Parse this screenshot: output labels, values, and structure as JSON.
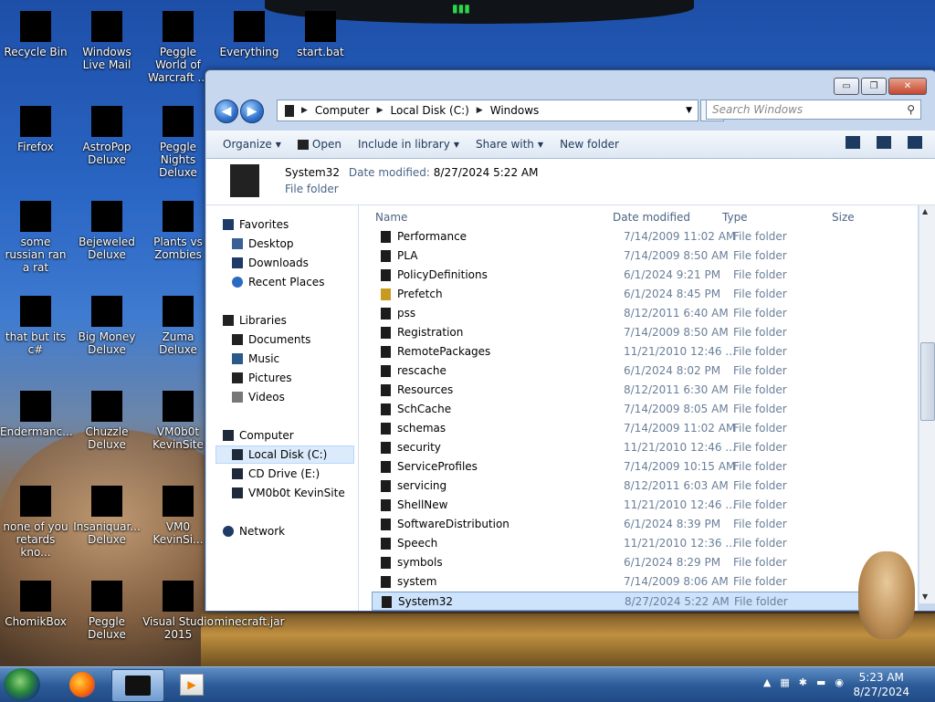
{
  "desktop": {
    "icons": [
      {
        "label": "Recycle Bin",
        "icon": "recycle-bin-icon"
      },
      {
        "label": "Windows Live Mail",
        "icon": "mail-icon"
      },
      {
        "label": "Peggle World of Warcraft ...",
        "icon": "peggle-icon"
      },
      {
        "label": "Everything",
        "icon": "search-app-icon"
      },
      {
        "label": "start.bat",
        "icon": "batch-file-icon"
      },
      {
        "label": "Firefox",
        "icon": "firefox-icon"
      },
      {
        "label": "AstroPop Deluxe",
        "icon": "game-icon"
      },
      {
        "label": "Peggle Nights Deluxe",
        "icon": "peggle-icon"
      },
      {
        "label": "some russian ran a rat",
        "icon": "file-icon"
      },
      {
        "label": "Bejeweled Deluxe",
        "icon": "game-icon"
      },
      {
        "label": "Plants vs Zombies",
        "icon": "game-icon"
      },
      {
        "label": "that but its c#",
        "icon": "file-icon"
      },
      {
        "label": "Big Money Deluxe",
        "icon": "game-icon"
      },
      {
        "label": "Zuma Deluxe",
        "icon": "game-icon"
      },
      {
        "label": "Endermanc...",
        "icon": "app-icon"
      },
      {
        "label": "Chuzzle Deluxe",
        "icon": "game-icon"
      },
      {
        "label": "VM0b0t KevinSite",
        "icon": "app-icon"
      },
      {
        "label": "none of you retards kno...",
        "icon": "file-icon"
      },
      {
        "label": "Insaniquar... Deluxe",
        "icon": "game-icon"
      },
      {
        "label": "VM0 KevinSi...",
        "icon": "app-icon"
      },
      {
        "label": "ChomikBox",
        "icon": "app-icon"
      },
      {
        "label": "Peggle Deluxe",
        "icon": "peggle-icon"
      },
      {
        "label": "Visual Studio 2015",
        "icon": "visual-studio-icon"
      },
      {
        "label": "minecraft.jar",
        "icon": "jar-file-icon"
      }
    ]
  },
  "window": {
    "controls": {
      "minimize": "▭",
      "maximize": "❐",
      "close": "✕"
    },
    "address": {
      "crumbs": [
        "Computer",
        "Local Disk (C:)",
        "Windows"
      ]
    },
    "search": {
      "placeholder": "Search Windows"
    },
    "toolbar": {
      "organize": "Organize",
      "open": "Open",
      "include": "Include in library",
      "share": "Share with",
      "new_folder": "New folder"
    },
    "details": {
      "name": "System32",
      "modified_label": "Date modified:",
      "modified_value": "8/27/2024 5:22 AM",
      "type": "File folder"
    },
    "nav": {
      "favorites": "Favorites",
      "desktop": "Desktop",
      "downloads": "Downloads",
      "recent": "Recent Places",
      "libraries": "Libraries",
      "documents": "Documents",
      "music": "Music",
      "pictures": "Pictures",
      "videos": "Videos",
      "computer": "Computer",
      "local_disk": "Local Disk (C:)",
      "cd_drive": "CD Drive (E:)",
      "vm_site": "VM0b0t KevinSite",
      "network": "Network"
    },
    "columns": {
      "name": "Name",
      "date": "Date modified",
      "type": "Type",
      "size": "Size"
    },
    "rows": [
      {
        "name": "Performance",
        "date": "7/14/2009 11:02 AM",
        "type": "File folder"
      },
      {
        "name": "PLA",
        "date": "7/14/2009 8:50 AM",
        "type": "File folder"
      },
      {
        "name": "PolicyDefinitions",
        "date": "6/1/2024 9:21 PM",
        "type": "File folder"
      },
      {
        "name": "Prefetch",
        "date": "6/1/2024 8:45 PM",
        "type": "File folder"
      },
      {
        "name": "pss",
        "date": "8/12/2011 6:40 AM",
        "type": "File folder"
      },
      {
        "name": "Registration",
        "date": "7/14/2009 8:50 AM",
        "type": "File folder"
      },
      {
        "name": "RemotePackages",
        "date": "11/21/2010 12:46 ...",
        "type": "File folder"
      },
      {
        "name": "rescache",
        "date": "6/1/2024 8:02 PM",
        "type": "File folder"
      },
      {
        "name": "Resources",
        "date": "8/12/2011 6:30 AM",
        "type": "File folder"
      },
      {
        "name": "SchCache",
        "date": "7/14/2009 8:05 AM",
        "type": "File folder"
      },
      {
        "name": "schemas",
        "date": "7/14/2009 11:02 AM",
        "type": "File folder"
      },
      {
        "name": "security",
        "date": "11/21/2010 12:46 ...",
        "type": "File folder"
      },
      {
        "name": "ServiceProfiles",
        "date": "7/14/2009 10:15 AM",
        "type": "File folder"
      },
      {
        "name": "servicing",
        "date": "8/12/2011 6:03 AM",
        "type": "File folder"
      },
      {
        "name": "ShellNew",
        "date": "11/21/2010 12:46 ...",
        "type": "File folder"
      },
      {
        "name": "SoftwareDistribution",
        "date": "6/1/2024 8:39 PM",
        "type": "File folder"
      },
      {
        "name": "Speech",
        "date": "11/21/2010 12:36 ...",
        "type": "File folder"
      },
      {
        "name": "symbols",
        "date": "6/1/2024 8:29 PM",
        "type": "File folder"
      },
      {
        "name": "system",
        "date": "7/14/2009 8:06 AM",
        "type": "File folder"
      },
      {
        "name": "System32",
        "date": "8/27/2024 5:22 AM",
        "type": "File folder",
        "selected": true
      }
    ]
  },
  "taskbar": {
    "time": "5:23 AM",
    "date": "8/27/2024",
    "apps": [
      "firefox-icon",
      "explorer-icon",
      "media-player-icon"
    ]
  }
}
